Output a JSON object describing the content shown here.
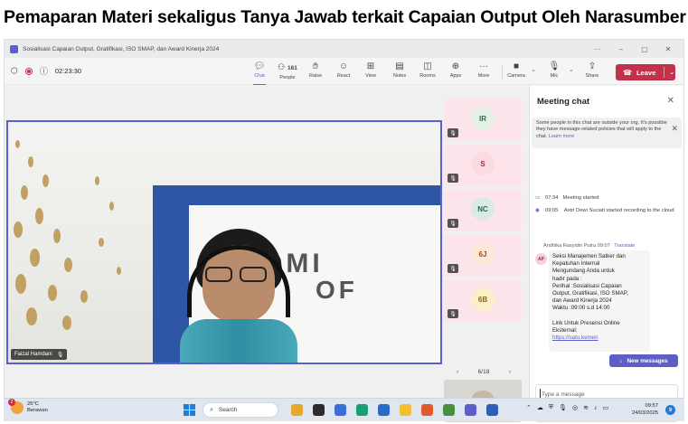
{
  "heading": "Pemaparan Materi sekaligus Tanya Jawab terkait Capaian Output Oleh Narasumber",
  "window": {
    "title": "Sosialisasi Capaian Output, Gratifikasi, ISO SMAP, dan Award Kinerja 2024",
    "more_glyph": "···",
    "min_glyph": "–",
    "max_glyph": "▢",
    "close_glyph": "✕"
  },
  "toolbar": {
    "timer": "02:23:30",
    "people_count": "161",
    "chat": "Chat",
    "people": "People",
    "raise": "Raise",
    "react": "React",
    "view": "View",
    "notes": "Notes",
    "rooms": "Rooms",
    "apps": "Apps",
    "more": "More",
    "camera": "Camera",
    "mic": "Mic",
    "share": "Share",
    "leave": "Leave"
  },
  "stage": {
    "speaker_name": "Faizal Hamdani",
    "wall_text_1": "OMI",
    "wall_text_2": "OF",
    "pager": "6/18"
  },
  "participants": [
    {
      "initials": "IR",
      "bg": "#e3f1e6",
      "color": "#2b6e3f"
    },
    {
      "initials": "S",
      "bg": "#fbdbe2",
      "color": "#a0294a"
    },
    {
      "initials": "NC",
      "bg": "#dbeae4",
      "color": "#216d52"
    },
    {
      "initials": "6J",
      "bg": "#fde7d8",
      "color": "#a24b1c"
    },
    {
      "initials": "6B",
      "bg": "#fbefc9",
      "color": "#8a6415"
    }
  ],
  "chat": {
    "title": "Meeting chat",
    "notice_text": "Some people in this chat are outside your org. It's possible they have message-related policies that will apply to the chat.",
    "notice_link": "Learn more",
    "events": [
      {
        "time": "07:34",
        "text": "Meeting started"
      },
      {
        "time": "09:05",
        "text": "Astri Dewi Suciati started recording to the cloud"
      }
    ],
    "message": {
      "author": "Andhika Rasyidin Putra",
      "time": "09:07",
      "translate": "Translate",
      "initials": "AP",
      "lines": [
        "Seksi Manajemen Satker dan",
        "Kepatuhan Internal",
        "Mengundang Anda untuk",
        "hadir pada :",
        "Perihal :Sosialisasi Capaian",
        "Output, Gratifikasi, ISO SMAP,",
        "dan Award Kinerja  2024",
        "Waktu :09:00 s.d 14:00",
        "",
        "Link Untuk Presensi Online",
        "Eksternal:"
      ],
      "link": "https://satu.kemen"
    },
    "new_messages": "New messages",
    "compose_placeholder": "Type a message"
  },
  "taskbar": {
    "temp": "26°C",
    "weather": "Berawan",
    "weather_badge": "2",
    "search": "Search",
    "time": "09:57",
    "date": "24/03/2025",
    "notif_count": "9"
  },
  "colors": {
    "accent": "#5b5fc7",
    "leave": "#c4314b"
  }
}
